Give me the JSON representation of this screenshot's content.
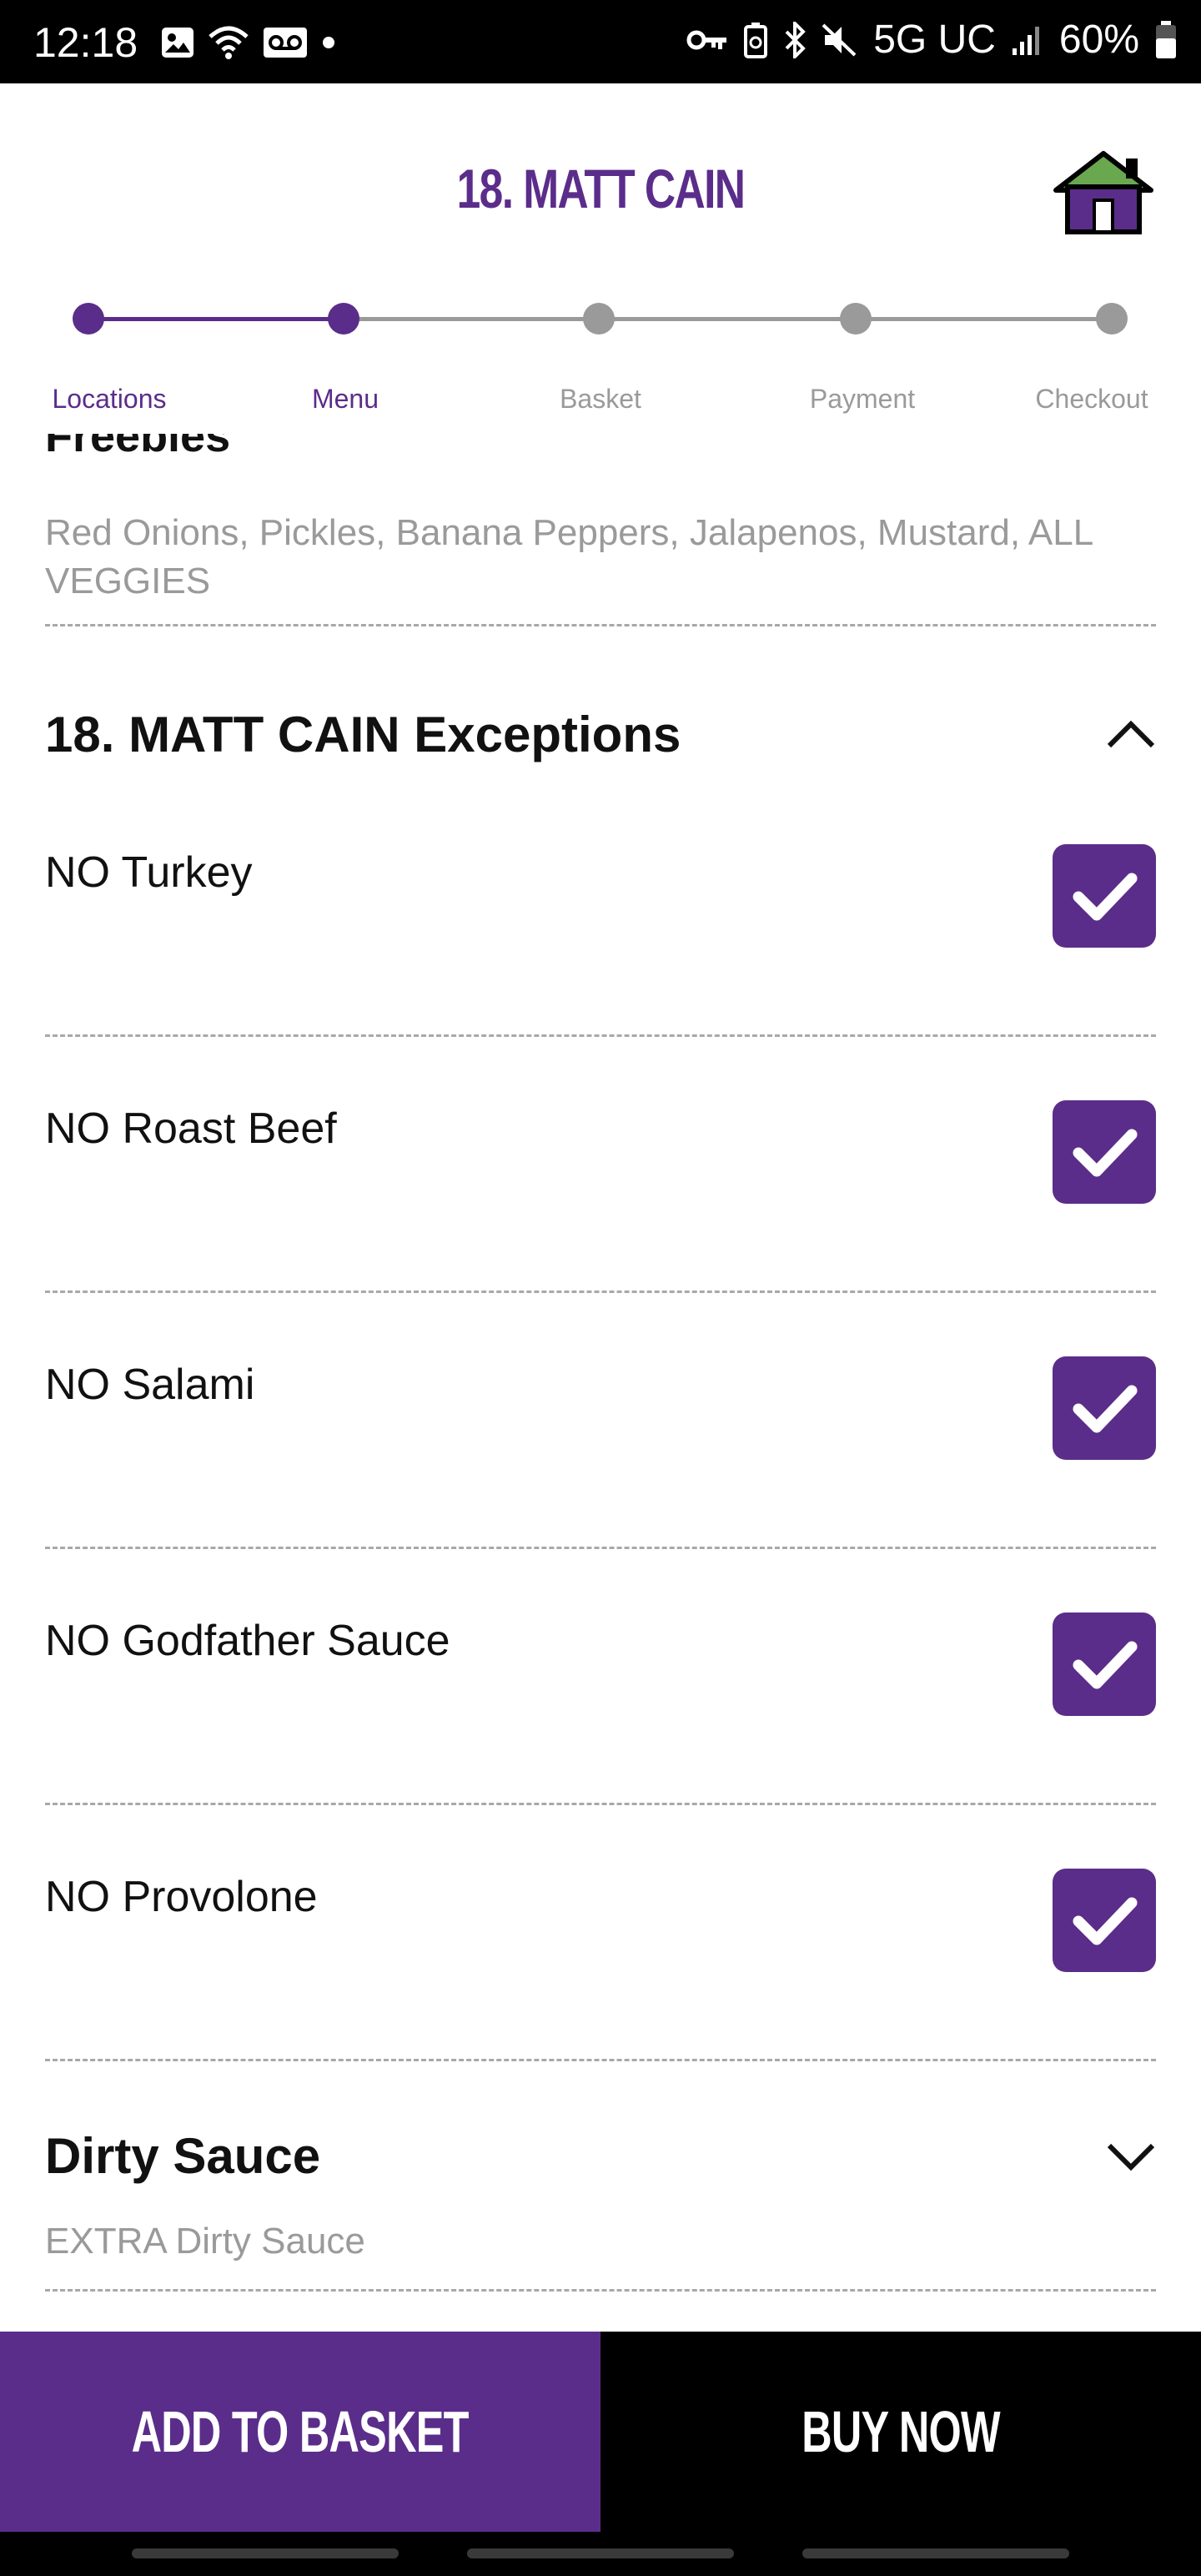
{
  "status_bar": {
    "time": "12:18",
    "network": "5G UC",
    "battery": "60%"
  },
  "header": {
    "title": "18. MATT CAIN",
    "home_icon": "home-icon"
  },
  "progress": {
    "steps": [
      {
        "label": "Locations",
        "state": "done"
      },
      {
        "label": "Menu",
        "state": "current"
      },
      {
        "label": "Basket",
        "state": "pending"
      },
      {
        "label": "Payment",
        "state": "pending"
      },
      {
        "label": "Checkout",
        "state": "pending"
      }
    ],
    "active_color": "#5b2d8a",
    "inactive_color": "#9a9a9a"
  },
  "freebies": {
    "title": "Freebies",
    "items_text": "Red Onions, Pickles, Banana Peppers, Jalapenos, Mustard, ALL VEGGIES"
  },
  "exceptions": {
    "title": "18. MATT CAIN Exceptions",
    "expanded": true,
    "options": [
      {
        "label": "NO Turkey",
        "checked": true
      },
      {
        "label": "NO Roast Beef",
        "checked": true
      },
      {
        "label": "NO Salami",
        "checked": true
      },
      {
        "label": "NO Godfather Sauce",
        "checked": true
      },
      {
        "label": "NO Provolone",
        "checked": true
      }
    ]
  },
  "dirty_sauce": {
    "title": "Dirty Sauce",
    "expanded": false,
    "subtitle": "EXTRA Dirty Sauce"
  },
  "actions": {
    "add_to_basket": "ADD TO BASKET",
    "buy_now": "BUY NOW"
  },
  "colors": {
    "brand_purple": "#5b2d8a",
    "muted_text": "#9a9a9a"
  }
}
